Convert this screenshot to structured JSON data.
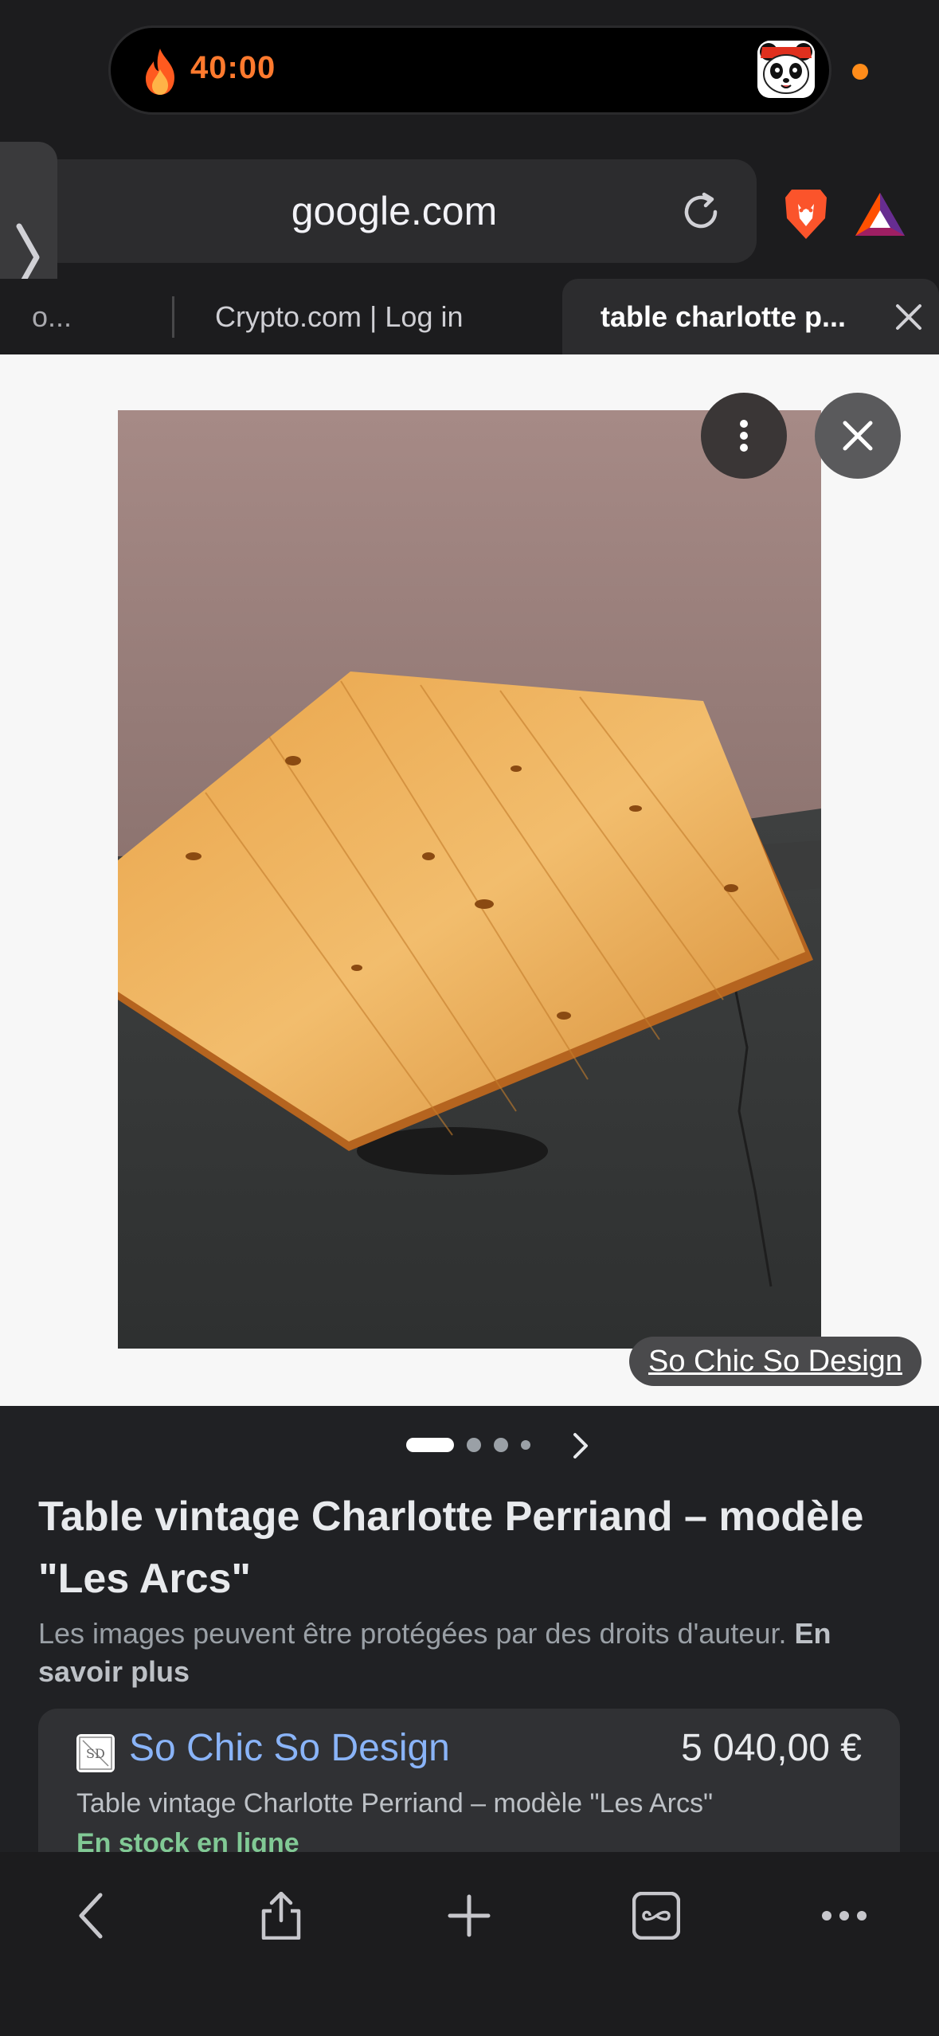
{
  "status_bar": {
    "timer": "40:00",
    "icons": [
      "flame-icon",
      "panda-avatar-icon",
      "recording-dot-icon"
    ]
  },
  "browser": {
    "url": "google.com",
    "tabs": [
      {
        "label": "o..."
      },
      {
        "label": "Crypto.com | Log in"
      },
      {
        "label": "table charlotte p..."
      }
    ],
    "icons": [
      "reload-icon",
      "brave-lion-icon",
      "bat-rewards-icon",
      "close-tab-icon"
    ]
  },
  "image_viewer": {
    "source_label": "So Chic So Design",
    "icons": [
      "more-options-icon",
      "close-icon"
    ]
  },
  "result": {
    "title": "Table vintage Charlotte Perriand – modèle \"Les Arcs\"",
    "copyright_text": "Les images peuvent être protégées par des droits d'auteur.",
    "learn_more": "En savoir plus",
    "seller": "So Chic So Design",
    "price": "5 040,00 €",
    "product_desc": "Table vintage Charlotte Perriand – modèle \"Les Arcs\"",
    "stock": "En stock en ligne"
  },
  "toolbar": {
    "icons": [
      "back-icon",
      "share-icon",
      "new-tab-icon",
      "tabs-icon",
      "more-icon"
    ]
  },
  "colors": {
    "timer": "#ff7a2e",
    "link": "#8ab4f8",
    "stock": "#81c995"
  }
}
